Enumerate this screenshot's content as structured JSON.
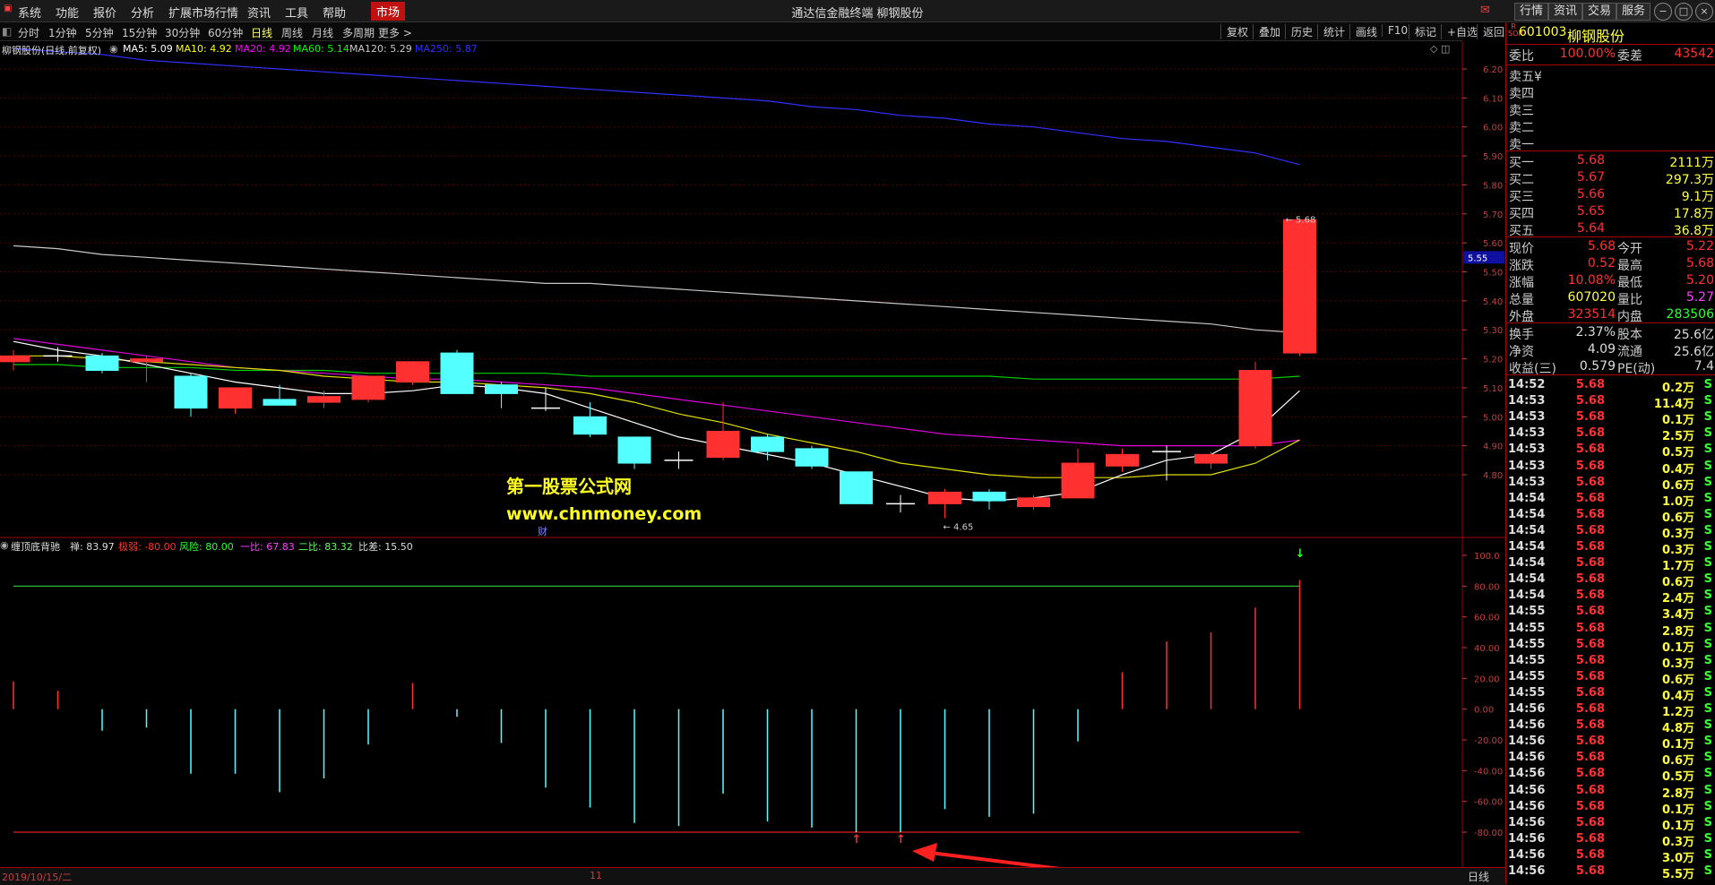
{
  "menubar": {
    "items": [
      "系统",
      "功能",
      "报价",
      "分析",
      "扩展市场行情",
      "资讯",
      "工具",
      "帮助"
    ],
    "market_label": "市场",
    "title": "通达信金融终端  柳钢股份",
    "right_buttons": [
      "行情",
      "资讯",
      "交易",
      "服务"
    ]
  },
  "period_bar": {
    "periods": [
      "分时",
      "1分钟",
      "5分钟",
      "15分钟",
      "30分钟",
      "60分钟",
      "日线",
      "周线",
      "月线",
      "多周期",
      "更多 >"
    ],
    "active": "日线",
    "tools": [
      "复权",
      "叠加",
      "历史",
      "统计",
      "画线",
      "F10",
      "标记",
      "+自选",
      "返回"
    ]
  },
  "main_chart": {
    "stock_label": "柳钢股份(日线,前复权)",
    "ma_legend": [
      {
        "text": "MA5: 5.09",
        "color": "#ffffff"
      },
      {
        "text": "MA10: 4.92",
        "color": "#ffff00"
      },
      {
        "text": "MA20: 4.92",
        "color": "#ff00ff"
      },
      {
        "text": "MA60: 5.14",
        "color": "#00ff00"
      },
      {
        "text": "MA120: 5.29",
        "color": "#c8c8c8"
      },
      {
        "text": "MA250: 5.87",
        "color": "#3030ff"
      }
    ],
    "y_ticks": [
      "6.20",
      "6.10",
      "6.00",
      "5.90",
      "5.80",
      "5.70",
      "5.60",
      "5.50",
      "5.40",
      "5.30",
      "5.20",
      "5.10",
      "5.00",
      "4.90",
      "4.80"
    ],
    "current_price_tag": "5.55",
    "high_annotation": "5.68",
    "low_annotation": "4.65",
    "watermark_title": "第一股票公式网",
    "watermark_url": "www.chnmoney.com",
    "finance_marker": "财"
  },
  "chart_data": {
    "type": "candlestick",
    "candles": [
      {
        "o": 5.21,
        "h": 5.23,
        "l": 5.16,
        "c": 5.19,
        "color": "red"
      },
      {
        "o": 5.21,
        "h": 5.24,
        "l": 5.19,
        "c": 5.21,
        "color": "cross"
      },
      {
        "o": 5.21,
        "h": 5.22,
        "l": 5.15,
        "c": 5.16,
        "color": "cyan"
      },
      {
        "o": 5.19,
        "h": 5.21,
        "l": 5.12,
        "c": 5.2,
        "color": "red"
      },
      {
        "o": 5.14,
        "h": 5.15,
        "l": 5.0,
        "c": 5.03,
        "color": "cyan"
      },
      {
        "o": 5.03,
        "h": 5.1,
        "l": 5.01,
        "c": 5.1,
        "color": "red"
      },
      {
        "o": 5.06,
        "h": 5.11,
        "l": 5.04,
        "c": 5.04,
        "color": "cyan"
      },
      {
        "o": 5.05,
        "h": 5.09,
        "l": 5.03,
        "c": 5.07,
        "color": "red"
      },
      {
        "o": 5.06,
        "h": 5.14,
        "l": 5.05,
        "c": 5.14,
        "color": "red"
      },
      {
        "o": 5.12,
        "h": 5.19,
        "l": 5.11,
        "c": 5.19,
        "color": "red"
      },
      {
        "o": 5.22,
        "h": 5.23,
        "l": 5.08,
        "c": 5.08,
        "color": "cyan"
      },
      {
        "o": 5.11,
        "h": 5.12,
        "l": 5.03,
        "c": 5.08,
        "color": "cyan"
      },
      {
        "o": 5.03,
        "h": 5.1,
        "l": 5.02,
        "c": 5.03,
        "color": "cross"
      },
      {
        "o": 5.0,
        "h": 5.05,
        "l": 4.93,
        "c": 4.94,
        "color": "cyan"
      },
      {
        "o": 4.93,
        "h": 4.93,
        "l": 4.82,
        "c": 4.84,
        "color": "cyan"
      },
      {
        "o": 4.85,
        "h": 4.88,
        "l": 4.82,
        "c": 4.85,
        "color": "cross"
      },
      {
        "o": 4.86,
        "h": 5.05,
        "l": 4.85,
        "c": 4.95,
        "color": "red"
      },
      {
        "o": 4.93,
        "h": 4.94,
        "l": 4.85,
        "c": 4.88,
        "color": "cyan"
      },
      {
        "o": 4.89,
        "h": 4.9,
        "l": 4.82,
        "c": 4.83,
        "color": "cyan"
      },
      {
        "o": 4.81,
        "h": 4.81,
        "l": 4.7,
        "c": 4.7,
        "color": "cyan"
      },
      {
        "o": 4.7,
        "h": 4.73,
        "l": 4.67,
        "c": 4.7,
        "color": "cross"
      },
      {
        "o": 4.7,
        "h": 4.75,
        "l": 4.65,
        "c": 4.74,
        "color": "red"
      },
      {
        "o": 4.74,
        "h": 4.75,
        "l": 4.68,
        "c": 4.71,
        "color": "cyan"
      },
      {
        "o": 4.69,
        "h": 4.73,
        "l": 4.68,
        "c": 4.72,
        "color": "red"
      },
      {
        "o": 4.72,
        "h": 4.89,
        "l": 4.72,
        "c": 4.84,
        "color": "red"
      },
      {
        "o": 4.83,
        "h": 4.89,
        "l": 4.81,
        "c": 4.87,
        "color": "red"
      },
      {
        "o": 4.88,
        "h": 4.9,
        "l": 4.78,
        "c": 4.88,
        "color": "cross"
      },
      {
        "o": 4.84,
        "h": 4.88,
        "l": 4.82,
        "c": 4.87,
        "color": "red"
      },
      {
        "o": 4.9,
        "h": 5.19,
        "l": 4.89,
        "c": 5.16,
        "color": "red"
      },
      {
        "o": 5.22,
        "h": 5.68,
        "l": 5.21,
        "c": 5.68,
        "color": "red"
      }
    ],
    "ma5": [
      5.26,
      5.23,
      5.21,
      5.18,
      5.15,
      5.12,
      5.1,
      5.08,
      5.08,
      5.09,
      5.11,
      5.1,
      5.08,
      5.03,
      4.98,
      4.93,
      4.9,
      4.87,
      4.84,
      4.8,
      4.76,
      4.72,
      4.71,
      4.72,
      4.74,
      4.8,
      4.85,
      4.87,
      4.95,
      5.09
    ],
    "ma10": [
      5.21,
      5.21,
      5.2,
      5.19,
      5.18,
      5.17,
      5.16,
      5.14,
      5.13,
      5.12,
      5.12,
      5.11,
      5.1,
      5.08,
      5.05,
      5.01,
      4.98,
      4.94,
      4.91,
      4.88,
      4.84,
      4.82,
      4.8,
      4.79,
      4.79,
      4.79,
      4.8,
      4.8,
      4.84,
      4.92
    ],
    "ma20": [
      5.27,
      5.25,
      5.23,
      5.21,
      5.19,
      5.17,
      5.16,
      5.15,
      5.14,
      5.13,
      5.13,
      5.12,
      5.11,
      5.1,
      5.08,
      5.06,
      5.04,
      5.02,
      5.0,
      4.98,
      4.96,
      4.94,
      4.93,
      4.92,
      4.91,
      4.9,
      4.9,
      4.9,
      4.9,
      4.92
    ],
    "ma60": [
      5.18,
      5.18,
      5.17,
      5.17,
      5.17,
      5.16,
      5.16,
      5.16,
      5.15,
      5.15,
      5.15,
      5.15,
      5.15,
      5.14,
      5.14,
      5.14,
      5.14,
      5.14,
      5.14,
      5.14,
      5.14,
      5.14,
      5.14,
      5.13,
      5.13,
      5.13,
      5.13,
      5.13,
      5.13,
      5.14
    ],
    "ma120": [
      5.59,
      5.58,
      5.56,
      5.55,
      5.54,
      5.53,
      5.52,
      5.51,
      5.5,
      5.49,
      5.48,
      5.47,
      5.46,
      5.46,
      5.45,
      5.44,
      5.43,
      5.42,
      5.41,
      5.4,
      5.39,
      5.38,
      5.37,
      5.36,
      5.35,
      5.34,
      5.33,
      5.32,
      5.3,
      5.29
    ],
    "ma250": [
      6.27,
      6.26,
      6.25,
      6.23,
      6.22,
      6.21,
      6.2,
      6.19,
      6.18,
      6.17,
      6.16,
      6.15,
      6.14,
      6.13,
      6.12,
      6.11,
      6.1,
      6.09,
      6.07,
      6.06,
      6.04,
      6.03,
      6.01,
      6.0,
      5.98,
      5.96,
      5.95,
      5.93,
      5.91,
      5.87
    ],
    "y_range": [
      4.6,
      6.25
    ],
    "indicator": {
      "name": "缠顶底背驰",
      "legend": [
        {
          "text": "缠顶底背驰",
          "color": "#dddddd"
        },
        {
          "text": "禅: 83.97",
          "color": "#dddddd"
        },
        {
          "text": "极弱: -80.00",
          "color": "#ff3030"
        },
        {
          "text": "风险: 80.00",
          "color": "#30ff30"
        },
        {
          "text": "一比: 67.83",
          "color": "#ff40ff"
        },
        {
          "text": "二比: 83.32",
          "color": "#60ff60"
        },
        {
          "text": "比差: 15.50",
          "color": "#dddddd"
        }
      ],
      "y_ticks": [
        "100.0",
        "80.00",
        "60.00",
        "40.00",
        "20.00",
        "0.00",
        "-20.00",
        "-40.00",
        "-60.00",
        "-80.00"
      ],
      "y_range": [
        -85,
        105
      ],
      "values": [
        18,
        12,
        -14,
        -12,
        -42,
        -42,
        -54,
        -45,
        -23,
        17,
        -5,
        -22,
        -51,
        -64,
        -74,
        -76,
        -55,
        -73,
        -77,
        -80,
        -80,
        -65,
        -70,
        -68,
        -21,
        24,
        44,
        50,
        66,
        84
      ],
      "upper_level": 80,
      "lower_level": -80,
      "buy_arrow_bars": [
        19,
        20
      ],
      "sell_arrow_bar": 29
    }
  },
  "bottom_bar": {
    "start_date": "2019/10/15/二",
    "month_label": "11",
    "period_label": "日线"
  },
  "quote_panel": {
    "code": "601003",
    "name": "柳钢股份",
    "badge": "R\nSOR",
    "weibi_label": "委比",
    "weibi_value": "100.00%",
    "weicha_label": "委差",
    "weicha_value": "43542",
    "sell_levels": [
      {
        "label": "卖五",
        "price": "",
        "vol": ""
      },
      {
        "label": "卖四",
        "price": "",
        "vol": ""
      },
      {
        "label": "卖三",
        "price": "",
        "vol": ""
      },
      {
        "label": "卖二",
        "price": "",
        "vol": ""
      },
      {
        "label": "卖一",
        "price": "",
        "vol": ""
      }
    ],
    "sell_five_suffix": "¥",
    "buy_levels": [
      {
        "label": "买一",
        "price": "5.68",
        "vol": "2111万"
      },
      {
        "label": "买二",
        "price": "5.67",
        "vol": "297.3万"
      },
      {
        "label": "买三",
        "price": "5.66",
        "vol": "9.1万"
      },
      {
        "label": "买四",
        "price": "5.65",
        "vol": "17.8万"
      },
      {
        "label": "买五",
        "price": "5.64",
        "vol": "36.8万"
      }
    ],
    "stats": [
      {
        "l1": "现价",
        "v1": "5.68",
        "c1": "#ff3030",
        "l2": "今开",
        "v2": "5.22",
        "c2": "#ff3030"
      },
      {
        "l1": "涨跌",
        "v1": "0.52",
        "c1": "#ff3030",
        "l2": "最高",
        "v2": "5.68",
        "c2": "#ff3030"
      },
      {
        "l1": "涨幅",
        "v1": "10.08%",
        "c1": "#ff3030",
        "l2": "最低",
        "v2": "5.20",
        "c2": "#ff3030"
      },
      {
        "l1": "总量",
        "v1": "607020",
        "c1": "#ffff40",
        "l2": "量比",
        "v2": "5.27",
        "c2": "#ff40ff"
      },
      {
        "l1": "外盘",
        "v1": "323514",
        "c1": "#ff3030",
        "l2": "内盘",
        "v2": "283506",
        "c2": "#30ff30"
      }
    ],
    "stats2": [
      {
        "l1": "换手",
        "v1": "2.37%",
        "l2": "股本",
        "v2": "25.6亿"
      },
      {
        "l1": "净资",
        "v1": "4.09",
        "l2": "流通",
        "v2": "25.6亿"
      },
      {
        "l1": "收益(三)",
        "v1": "0.579",
        "l2": "PE(动)",
        "v2": "7.4"
      }
    ],
    "ticks": [
      {
        "t": "14:52",
        "p": "5.68",
        "v": "0.2万",
        "s": "S"
      },
      {
        "t": "14:53",
        "p": "5.68",
        "v": "11.4万",
        "s": "S"
      },
      {
        "t": "14:53",
        "p": "5.68",
        "v": "0.1万",
        "s": "S"
      },
      {
        "t": "14:53",
        "p": "5.68",
        "v": "2.5万",
        "s": "S"
      },
      {
        "t": "14:53",
        "p": "5.68",
        "v": "0.5万",
        "s": "S"
      },
      {
        "t": "14:53",
        "p": "5.68",
        "v": "0.4万",
        "s": "S"
      },
      {
        "t": "14:53",
        "p": "5.68",
        "v": "0.6万",
        "s": "S"
      },
      {
        "t": "14:54",
        "p": "5.68",
        "v": "1.0万",
        "s": "S"
      },
      {
        "t": "14:54",
        "p": "5.68",
        "v": "0.6万",
        "s": "S"
      },
      {
        "t": "14:54",
        "p": "5.68",
        "v": "0.3万",
        "s": "S"
      },
      {
        "t": "14:54",
        "p": "5.68",
        "v": "0.3万",
        "s": "S"
      },
      {
        "t": "14:54",
        "p": "5.68",
        "v": "1.7万",
        "s": "S"
      },
      {
        "t": "14:54",
        "p": "5.68",
        "v": "0.6万",
        "s": "S"
      },
      {
        "t": "14:54",
        "p": "5.68",
        "v": "2.4万",
        "s": "S"
      },
      {
        "t": "14:55",
        "p": "5.68",
        "v": "3.4万",
        "s": "S"
      },
      {
        "t": "14:55",
        "p": "5.68",
        "v": "2.8万",
        "s": "S"
      },
      {
        "t": "14:55",
        "p": "5.68",
        "v": "0.1万",
        "s": "S"
      },
      {
        "t": "14:55",
        "p": "5.68",
        "v": "0.3万",
        "s": "S"
      },
      {
        "t": "14:55",
        "p": "5.68",
        "v": "0.6万",
        "s": "S"
      },
      {
        "t": "14:55",
        "p": "5.68",
        "v": "0.4万",
        "s": "S"
      },
      {
        "t": "14:56",
        "p": "5.68",
        "v": "1.2万",
        "s": "S"
      },
      {
        "t": "14:56",
        "p": "5.68",
        "v": "4.8万",
        "s": "S"
      },
      {
        "t": "14:56",
        "p": "5.68",
        "v": "0.1万",
        "s": "S"
      },
      {
        "t": "14:56",
        "p": "5.68",
        "v": "0.6万",
        "s": "S"
      },
      {
        "t": "14:56",
        "p": "5.68",
        "v": "0.5万",
        "s": "S"
      },
      {
        "t": "14:56",
        "p": "5.68",
        "v": "2.8万",
        "s": "S"
      },
      {
        "t": "14:56",
        "p": "5.68",
        "v": "0.1万",
        "s": "S"
      },
      {
        "t": "14:56",
        "p": "5.68",
        "v": "0.1万",
        "s": "S"
      },
      {
        "t": "14:56",
        "p": "5.68",
        "v": "0.3万",
        "s": "S"
      },
      {
        "t": "14:56",
        "p": "5.68",
        "v": "3.0万",
        "s": "S"
      },
      {
        "t": "14:56",
        "p": "5.68",
        "v": "5.5万",
        "s": "S"
      }
    ]
  },
  "colors": {
    "up": "#ff3030",
    "down": "#54ffff",
    "grid": "#7a0000",
    "axis": "#c04040"
  }
}
